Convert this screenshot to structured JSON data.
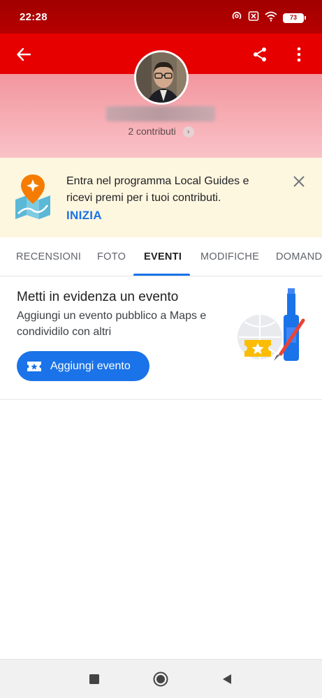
{
  "status_bar": {
    "time": "22:28",
    "battery": "73",
    "icons": [
      "hotspot-icon",
      "no-sim-icon",
      "wifi-icon",
      "battery-icon"
    ]
  },
  "app_bar": {
    "color": "#e60000",
    "icons": [
      "back-arrow-icon",
      "share-icon",
      "more-vert-icon"
    ]
  },
  "profile": {
    "contributions": "2 contributi"
  },
  "promo": {
    "text": "Entra nel programma Local Guides e ricevi premi per i tuoi contributi.",
    "cta": "INIZIA",
    "icons": [
      "local-guides-map-icon",
      "close-icon"
    ]
  },
  "tabs": [
    {
      "label": "RECENSIONI",
      "active": false
    },
    {
      "label": "FOTO",
      "active": false
    },
    {
      "label": "EVENTI",
      "active": true
    },
    {
      "label": "MODIFICHE",
      "active": false
    },
    {
      "label": "DOMANDE",
      "active": false
    }
  ],
  "events": {
    "title": "Metti in evidenza un evento",
    "description": "Aggiungi un evento pubblico a Maps e condividilo con altri",
    "button_label": "Aggiungi evento",
    "button_icon": "event-ticket-icon",
    "accent": "#1a73e8"
  },
  "nav_bar": {
    "icons": [
      "recents-square-icon",
      "home-circle-icon",
      "back-triangle-icon"
    ]
  }
}
